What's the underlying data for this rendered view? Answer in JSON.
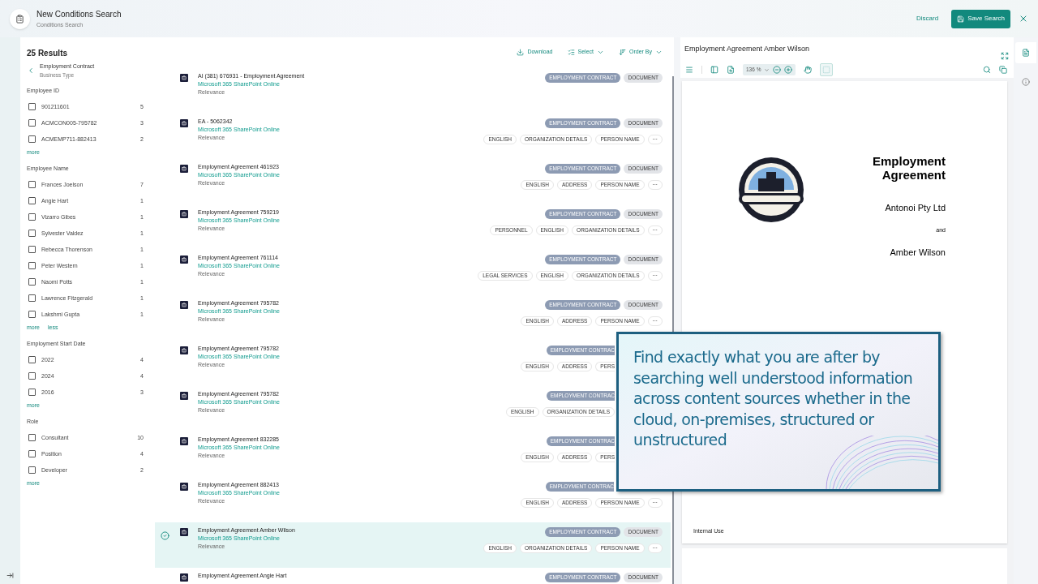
{
  "header": {
    "title": "New Conditions Search",
    "subtitle": "Conditions Search",
    "discard": "Discard",
    "save": "Save Search"
  },
  "filters": {
    "count": "25 Results",
    "breadcrumb": {
      "title": "Employment Contract",
      "subtitle": "Business Type"
    },
    "groups": [
      {
        "title": "Employee ID",
        "options": [
          {
            "label": "901211601",
            "count": "5",
            "checked": false
          },
          {
            "label": "ACMCON005-795782",
            "count": "3",
            "checked": false
          },
          {
            "label": "ACMEMP711-882413",
            "count": "2",
            "checked": false
          }
        ],
        "links": [
          "more"
        ]
      },
      {
        "title": "Employee Name",
        "options": [
          {
            "label": "Frances Joelson",
            "count": "7",
            "checked": false
          },
          {
            "label": "Angie Hart",
            "count": "1",
            "checked": false
          },
          {
            "label": "Vizarro Gibes",
            "count": "1",
            "checked": false
          },
          {
            "label": "Sylvester Valdez",
            "count": "1",
            "checked": false
          },
          {
            "label": "Rebecca Thorenson",
            "count": "1",
            "checked": false
          },
          {
            "label": "Peter Western",
            "count": "1",
            "checked": false
          },
          {
            "label": "Naomi Potts",
            "count": "1",
            "checked": false
          },
          {
            "label": "Lawrence Fitzgerald",
            "count": "1",
            "checked": false
          },
          {
            "label": "Lakshmi Gupta",
            "count": "1",
            "checked": false
          }
        ],
        "links": [
          "more",
          "less"
        ]
      },
      {
        "title": "Employment Start Date",
        "options": [
          {
            "label": "2022",
            "count": "4",
            "checked": false
          },
          {
            "label": "2024",
            "count": "4",
            "checked": false
          },
          {
            "label": "2016",
            "count": "3",
            "checked": false
          }
        ],
        "links": [
          "more"
        ]
      },
      {
        "title": "Role",
        "options": [
          {
            "label": "Consultant",
            "count": "10",
            "checked": false
          },
          {
            "label": "Position",
            "count": "4",
            "checked": false
          },
          {
            "label": "Developer",
            "count": "2",
            "checked": false
          }
        ],
        "links": [
          "more"
        ]
      }
    ]
  },
  "toolbar": [
    {
      "label": "Download",
      "kind": "download",
      "dropdown": false
    },
    {
      "label": "Select",
      "kind": "select",
      "dropdown": true
    },
    {
      "label": "Order By",
      "kind": "order",
      "dropdown": true
    }
  ],
  "results": [
    {
      "title": "AI (381) 676931 - Employment Agreement",
      "source": "Microsoft 365 SharePoint Online",
      "meta": "Relevance",
      "selected": false,
      "partly_hidden": false,
      "tags": [
        {
          "label": "EMPLOYMENT CONTRACT",
          "kind": "type"
        },
        {
          "label": "DOCUMENT",
          "kind": "category"
        }
      ]
    },
    {
      "title": "EA - 5062342",
      "source": "Microsoft 365 SharePoint Online",
      "meta": "Relevance",
      "selected": false,
      "partly_hidden": false,
      "tags": [
        {
          "label": "EMPLOYMENT CONTRACT",
          "kind": "type"
        },
        {
          "label": "DOCUMENT",
          "kind": "category"
        }
      ],
      "labels": [
        {
          "label": "ENGLISH",
          "kind": "label"
        },
        {
          "label": "ORGANIZATION DETAILS",
          "kind": "label"
        },
        {
          "label": "PERSON NAME",
          "kind": "label"
        }
      ],
      "more": "···"
    },
    {
      "title": "Employment Agreement 461923",
      "source": "Microsoft 365 SharePoint Online",
      "meta": "Relevance",
      "selected": false,
      "partly_hidden": false,
      "tags": [
        {
          "label": "EMPLOYMENT CONTRACT",
          "kind": "type"
        },
        {
          "label": "DOCUMENT",
          "kind": "category"
        }
      ],
      "labels": [
        {
          "label": "ENGLISH",
          "kind": "label"
        },
        {
          "label": "ADDRESS",
          "kind": "label"
        },
        {
          "label": "PERSON NAME",
          "kind": "label"
        }
      ],
      "more": "···"
    },
    {
      "title": "Employment Agreement 759219",
      "source": "Microsoft 365 SharePoint Online",
      "meta": "Relevance",
      "selected": false,
      "partly_hidden": false,
      "tags": [
        {
          "label": "EMPLOYMENT CONTRACT",
          "kind": "type"
        },
        {
          "label": "DOCUMENT",
          "kind": "category"
        }
      ],
      "labels": [
        {
          "label": "PERSONNEL",
          "kind": "label"
        },
        {
          "label": "ENGLISH",
          "kind": "label"
        },
        {
          "label": "ORGANIZATION DETAILS",
          "kind": "label"
        }
      ],
      "more": "···"
    },
    {
      "title": "Employment Agreement 761114",
      "source": "Microsoft 365 SharePoint Online",
      "meta": "Relevance",
      "selected": false,
      "partly_hidden": false,
      "tags": [
        {
          "label": "EMPLOYMENT CONTRACT",
          "kind": "type"
        },
        {
          "label": "DOCUMENT",
          "kind": "category"
        }
      ],
      "labels": [
        {
          "label": "LEGAL SERVICES",
          "kind": "label"
        },
        {
          "label": "ENGLISH",
          "kind": "label"
        },
        {
          "label": "ORGANIZATION DETAILS",
          "kind": "label"
        }
      ],
      "more": "···"
    },
    {
      "title": "Employment Agreement 795782",
      "source": "Microsoft 365 SharePoint Online",
      "meta": "Relevance",
      "selected": false,
      "partly_hidden": false,
      "tags": [
        {
          "label": "EMPLOYMENT CONTRACT",
          "kind": "type"
        },
        {
          "label": "DOCUMENT",
          "kind": "category"
        }
      ],
      "labels": [
        {
          "label": "ENGLISH",
          "kind": "label"
        },
        {
          "label": "ADDRESS",
          "kind": "label"
        },
        {
          "label": "PERSON NAME",
          "kind": "label"
        }
      ],
      "more": "···"
    },
    {
      "title": "Employment Agreement 795782",
      "source": "Microsoft 365 SharePoint Online",
      "meta": "Relevance",
      "selected": false,
      "partly_hidden": true,
      "tags": [
        {
          "label": "EMPLOYMENT CONTRAC",
          "kind": "cut_type"
        }
      ],
      "labels": [
        {
          "label": "ENGLISH",
          "kind": "label"
        },
        {
          "label": "ADDRESS",
          "kind": "label"
        },
        {
          "label": "PERS",
          "kind": "cut_label"
        }
      ]
    },
    {
      "title": "Employment Agreement 795782",
      "source": "Microsoft 365 SharePoint Online",
      "meta": "Relevance",
      "selected": false,
      "partly_hidden": true,
      "tags": [
        {
          "label": "EMPLOYMENT CONTRAC",
          "kind": "cut_type"
        }
      ],
      "labels": [
        {
          "label": "ENGLISH",
          "kind": "label"
        },
        {
          "label": "ORGANIZATION DETAILS",
          "kind": "label"
        }
      ]
    },
    {
      "title": "Employment Agreement 832285",
      "source": "Microsoft 365 SharePoint Online",
      "meta": "Relevance",
      "selected": false,
      "partly_hidden": true,
      "tags": [
        {
          "label": "EMPLOYMENT CONTRAC",
          "kind": "cut_type"
        }
      ],
      "labels": [
        {
          "label": "ENGLISH",
          "kind": "label"
        },
        {
          "label": "ADDRESS",
          "kind": "label"
        },
        {
          "label": "PERS",
          "kind": "cut_label"
        }
      ]
    },
    {
      "title": "Employment Agreement 882413",
      "source": "Microsoft 365 SharePoint Online",
      "meta": "Relevance",
      "selected": false,
      "partly_hidden": false,
      "tags": [
        {
          "label": "EMPLOYMENT CONTRAC",
          "kind": "cut_type"
        }
      ],
      "labels": [
        {
          "label": "ENGLISH",
          "kind": "label"
        },
        {
          "label": "ADDRESS",
          "kind": "label"
        },
        {
          "label": "PERSON NAME",
          "kind": "label"
        }
      ],
      "more": "···"
    },
    {
      "title": "Employment Agreement Amber Wilson",
      "source": "Microsoft 365 SharePoint Online",
      "meta": "Relevance",
      "selected": true,
      "partly_hidden": false,
      "tags": [
        {
          "label": "EMPLOYMENT CONTRACT",
          "kind": "type"
        },
        {
          "label": "DOCUMENT",
          "kind": "category"
        }
      ],
      "labels": [
        {
          "label": "ENGLISH",
          "kind": "label"
        },
        {
          "label": "ORGANIZATION DETAILS",
          "kind": "label"
        },
        {
          "label": "PERSON NAME",
          "kind": "label"
        }
      ],
      "more": "···"
    },
    {
      "title": "Employment Agreement Angie Hart",
      "selected": false,
      "partly_hidden": false,
      "tags": [
        {
          "label": "EMPLOYMENT CONTRACT",
          "kind": "type"
        },
        {
          "label": "DOCUMENT",
          "kind": "category"
        }
      ]
    }
  ],
  "preview": {
    "title": "Employment Agreement Amber Wilson",
    "zoom": "136 %",
    "document": {
      "heading": "Employment Agreement",
      "company": "Antonoi Pty Ltd",
      "conjunction": "and",
      "party": "Amber Wilson",
      "footer": "Internal Use"
    }
  },
  "rail": [
    {
      "kind": "document",
      "selected": true
    },
    {
      "kind": "info",
      "selected": false
    }
  ],
  "callout": {
    "text": "Find exactly what you are after by searching well understood information across content sources whether in the cloud, on-premises, structured or unstructured"
  }
}
